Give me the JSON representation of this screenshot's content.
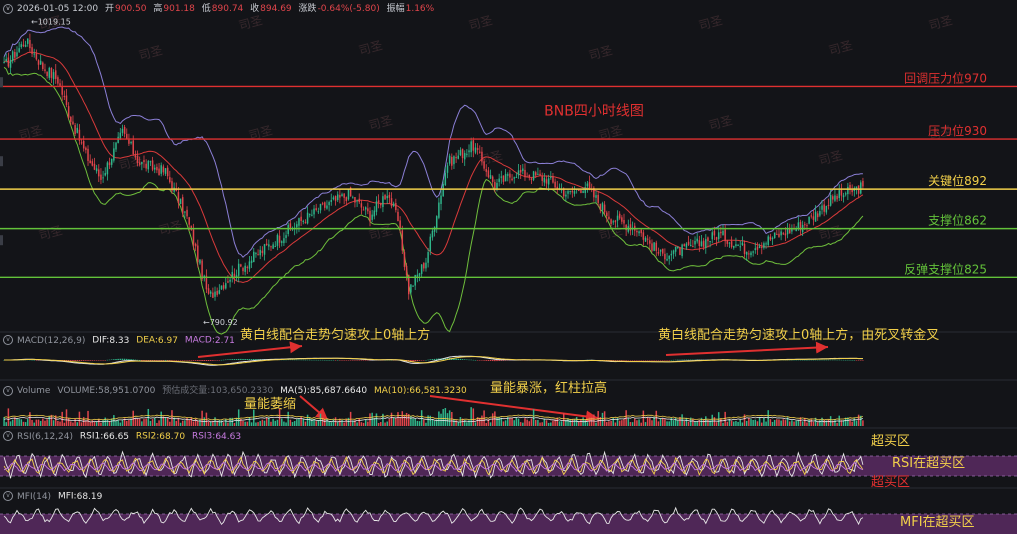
{
  "header": {
    "datetime": "2026-01-05 12:00",
    "open_label": "开",
    "open": "900.50",
    "high_label": "高",
    "high": "901.18",
    "low_label": "低",
    "low": "890.74",
    "close_label": "收",
    "close": "894.69",
    "change_label": "涨跌",
    "change": "-0.64%(-5.80)",
    "amplitude_label": "振幅",
    "amplitude": "1.16%"
  },
  "watermark": "司圣",
  "chart_data": {
    "type": "line",
    "title": "BNB四小时线图",
    "price_high_marker": "1019.15",
    "price_low_marker": "790.92",
    "levels": [
      {
        "label": "回调压力位970",
        "value": 970,
        "color": "#e03030"
      },
      {
        "label": "压力位930",
        "value": 930,
        "color": "#e03030"
      },
      {
        "label": "关键位892",
        "value": 892,
        "color": "#f2d04a"
      },
      {
        "label": "支撑位862",
        "value": 862,
        "color": "#63c23a"
      },
      {
        "label": "反弹支撑位825",
        "value": 825,
        "color": "#63c23a"
      }
    ],
    "ylim": [
      785,
      1025
    ],
    "anchors": [
      [
        0,
        985
      ],
      [
        10,
        1005
      ],
      [
        18,
        985
      ],
      [
        25,
        975
      ],
      [
        30,
        950
      ],
      [
        38,
        918
      ],
      [
        45,
        900
      ],
      [
        55,
        935
      ],
      [
        63,
        912
      ],
      [
        75,
        905
      ],
      [
        85,
        870
      ],
      [
        95,
        810
      ],
      [
        108,
        830
      ],
      [
        122,
        848
      ],
      [
        138,
        868
      ],
      [
        150,
        880
      ],
      [
        160,
        888
      ],
      [
        170,
        872
      ],
      [
        178,
        890
      ],
      [
        183,
        868
      ],
      [
        188,
        815
      ],
      [
        196,
        838
      ],
      [
        206,
        912
      ],
      [
        218,
        925
      ],
      [
        228,
        895
      ],
      [
        238,
        905
      ],
      [
        252,
        900
      ],
      [
        262,
        888
      ],
      [
        270,
        895
      ],
      [
        282,
        870
      ],
      [
        294,
        862
      ],
      [
        305,
        842
      ],
      [
        318,
        847
      ],
      [
        332,
        858
      ],
      [
        345,
        846
      ],
      [
        358,
        856
      ],
      [
        372,
        866
      ],
      [
        385,
        885
      ],
      [
        399,
        894
      ]
    ],
    "macd": {
      "name": "MACD(12,26,9)",
      "dif_label": "DIF:",
      "dif": "8.33",
      "dea_label": "DEA:",
      "dea": "6.97",
      "macd_label": "MACD:",
      "macd": "2.71"
    },
    "volume": {
      "name": "Volume",
      "volume_label": "VOLUME:",
      "volume": "58,951.0700",
      "forecast_label": "预估成交量:",
      "forecast": "103,650.2330",
      "ma5_label": "MA(5):",
      "ma5": "85,687.6640",
      "ma10_label": "MA(10):",
      "ma10": "66,581.3230"
    },
    "rsi": {
      "name": "RSI(6,12,24)",
      "rsi1_label": "RSI1:",
      "rsi1": "66.65",
      "rsi2_label": "RSI2:",
      "rsi2": "68.70",
      "rsi3_label": "RSI3:",
      "rsi3": "64.63"
    },
    "mfi": {
      "name": "MFI(14)",
      "mfi_label": "MFI:",
      "mfi": "68.19"
    }
  },
  "annotations": {
    "macd_note_1": "黄白线配合走势匀速攻上0轴上方",
    "macd_note_2": "黄白线配合走势匀速攻上0轴上方，由死叉转金叉",
    "volume_note_1": "量能萎缩",
    "volume_note_2": "量能暴涨，红柱拉高",
    "rsi_overbought_1": "超买区",
    "rsi_note": "RSI在超买区",
    "rsi_overbought_2": "超买区",
    "mfi_note": "MFI在超买区"
  },
  "colors": {
    "background": "#131418",
    "up": "#2fb58a",
    "down": "#e0454b",
    "bb_upper": "#8b7fd6",
    "bb_lower": "#6fbf3c",
    "bb_mid": "#d93a3a",
    "yellow": "#f2d04a",
    "white_line": "#e8e8e8",
    "purple_band": "#5b2a63",
    "annotation_text": "#f2d04a",
    "arrow": "#e03030"
  }
}
